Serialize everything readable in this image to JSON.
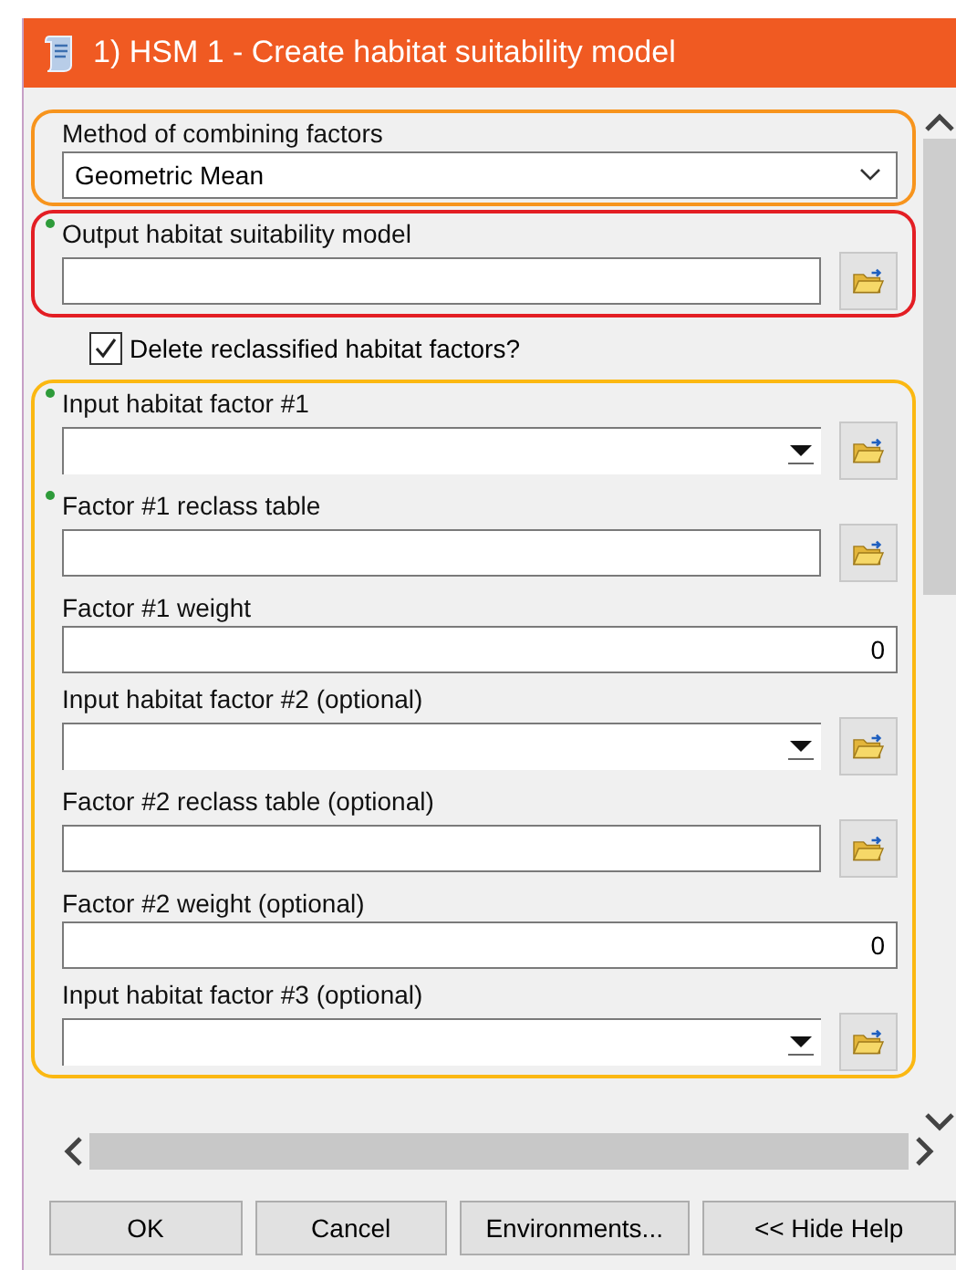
{
  "window": {
    "title": "1) HSM 1 - Create habitat suitability model"
  },
  "sections": [
    {
      "kind": "group",
      "color": "#f7941d",
      "items": [
        {
          "kind": "dropdown",
          "label": "Method of combining factors",
          "required": false,
          "value": "Geometric Mean"
        }
      ]
    },
    {
      "kind": "group",
      "color": "#e31e24",
      "items": [
        {
          "kind": "path",
          "label": "Output habitat suitability model",
          "required": true
        }
      ]
    },
    {
      "kind": "checkbox",
      "label": "Delete reclassified habitat factors?",
      "checked": true
    },
    {
      "kind": "group",
      "color": "#fbb812",
      "items": [
        {
          "kind": "combo",
          "label": "Input habitat factor #1",
          "required": true
        },
        {
          "kind": "path",
          "label": "Factor #1 reclass table",
          "required": true
        },
        {
          "kind": "number",
          "label": "Factor #1 weight",
          "required": false,
          "value": "0"
        },
        {
          "kind": "combo",
          "label": "Input habitat factor #2  (optional)",
          "required": false
        },
        {
          "kind": "path",
          "label": "Factor #2 reclass table (optional)",
          "required": false
        },
        {
          "kind": "number",
          "label": "Factor #2 weight (optional)",
          "required": false,
          "value": "0"
        },
        {
          "kind": "combo",
          "label": "Input habitat factor #3 (optional)",
          "required": false
        }
      ]
    }
  ],
  "buttons": [
    "OK",
    "Cancel",
    "Environments...",
    "<< Hide Help"
  ]
}
